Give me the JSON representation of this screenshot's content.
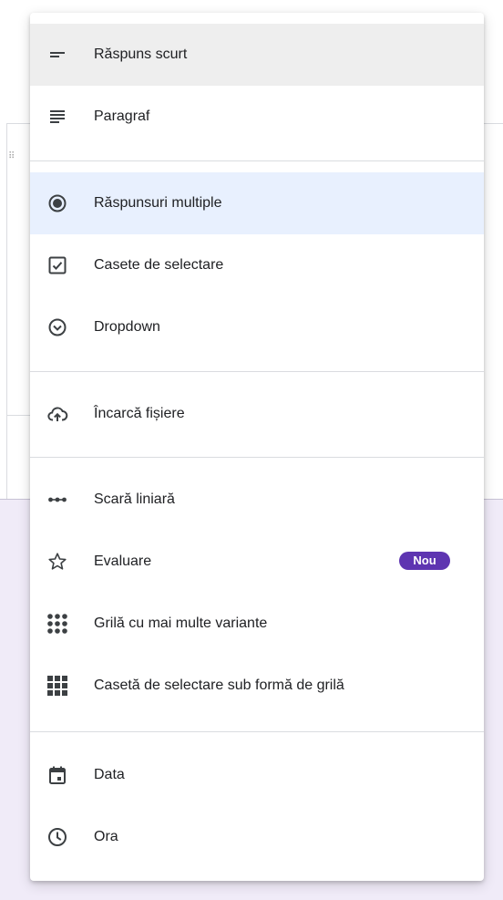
{
  "menu": {
    "items": [
      {
        "label": "Răspuns scurt",
        "icon": "short-answer-icon"
      },
      {
        "label": "Paragraf",
        "icon": "paragraph-icon"
      },
      {
        "label": "Răspunsuri multiple",
        "icon": "radio-button-icon"
      },
      {
        "label": "Casete de selectare",
        "icon": "checkbox-icon"
      },
      {
        "label": "Dropdown",
        "icon": "dropdown-icon"
      },
      {
        "label": "Încarcă fișiere",
        "icon": "cloud-upload-icon"
      },
      {
        "label": "Scară liniară",
        "icon": "linear-scale-icon"
      },
      {
        "label": "Evaluare",
        "icon": "star-icon",
        "badge": "Nou"
      },
      {
        "label": "Grilă cu mai multe variante",
        "icon": "dot-grid-icon"
      },
      {
        "label": "Casetă de selectare sub formă de grilă",
        "icon": "square-grid-icon"
      },
      {
        "label": "Data",
        "icon": "calendar-icon"
      },
      {
        "label": "Ora",
        "icon": "clock-icon"
      }
    ]
  },
  "colors": {
    "hover_bg": "#eeeeee",
    "selected_bg": "#e8f0fe",
    "badge_bg": "#5e35b1",
    "page_accent": "#f0ebf8",
    "icon": "#3c4043"
  }
}
